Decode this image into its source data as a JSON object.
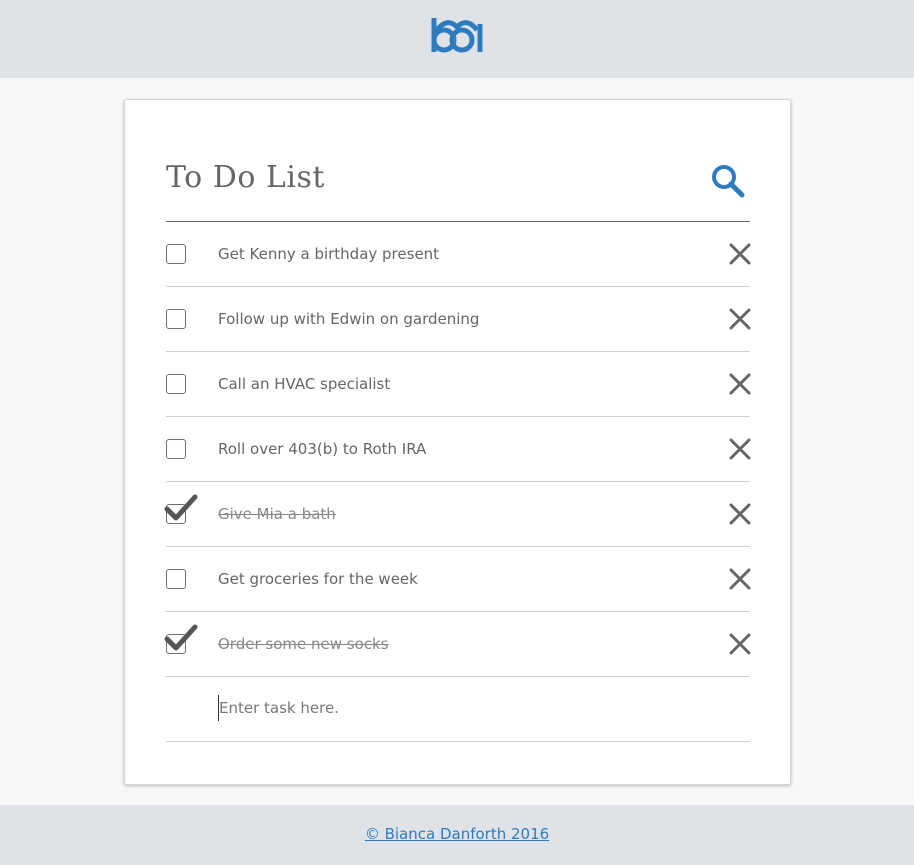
{
  "brand": {
    "logo_icon": "bd-logo-icon",
    "accent": "#2e7cbf"
  },
  "header": {
    "title": "To Do List",
    "search_icon": "search-icon"
  },
  "tasks": [
    {
      "label": "Get Kenny a birthday present",
      "done": false
    },
    {
      "label": "Follow up with Edwin on gardening",
      "done": false
    },
    {
      "label": "Call an HVAC specialist",
      "done": false
    },
    {
      "label": "Roll over 403(b) to Roth IRA",
      "done": false
    },
    {
      "label": "Give Mia a bath",
      "done": true
    },
    {
      "label": "Get groceries for the week",
      "done": false
    },
    {
      "label": "Order some new socks",
      "done": true
    }
  ],
  "new_task": {
    "placeholder": "Enter task here.",
    "value": ""
  },
  "footer": {
    "copyright": "© Bianca Danforth 2016"
  },
  "colors": {
    "text": "#666666",
    "link": "#2e7cbf",
    "bar_bg": "#dfe3e7"
  }
}
